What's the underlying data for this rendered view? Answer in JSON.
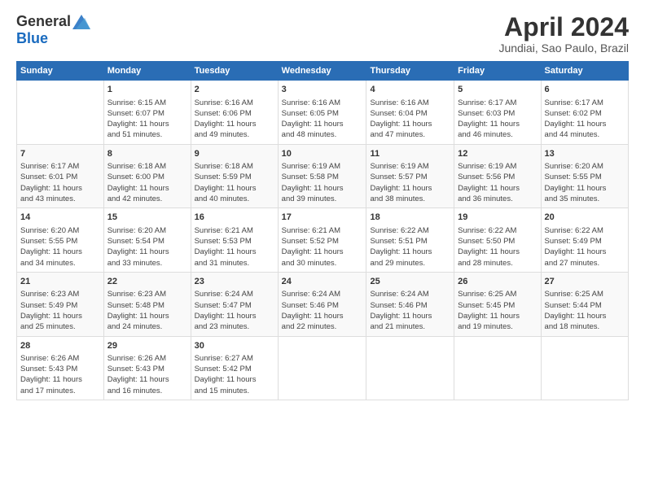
{
  "logo": {
    "general": "General",
    "blue": "Blue"
  },
  "title": "April 2024",
  "subtitle": "Jundiai, Sao Paulo, Brazil",
  "headers": [
    "Sunday",
    "Monday",
    "Tuesday",
    "Wednesday",
    "Thursday",
    "Friday",
    "Saturday"
  ],
  "weeks": [
    [
      {
        "day": "",
        "sunrise": "",
        "sunset": "",
        "daylight": ""
      },
      {
        "day": "1",
        "sunrise": "Sunrise: 6:15 AM",
        "sunset": "Sunset: 6:07 PM",
        "daylight": "Daylight: 11 hours and 51 minutes."
      },
      {
        "day": "2",
        "sunrise": "Sunrise: 6:16 AM",
        "sunset": "Sunset: 6:06 PM",
        "daylight": "Daylight: 11 hours and 49 minutes."
      },
      {
        "day": "3",
        "sunrise": "Sunrise: 6:16 AM",
        "sunset": "Sunset: 6:05 PM",
        "daylight": "Daylight: 11 hours and 48 minutes."
      },
      {
        "day": "4",
        "sunrise": "Sunrise: 6:16 AM",
        "sunset": "Sunset: 6:04 PM",
        "daylight": "Daylight: 11 hours and 47 minutes."
      },
      {
        "day": "5",
        "sunrise": "Sunrise: 6:17 AM",
        "sunset": "Sunset: 6:03 PM",
        "daylight": "Daylight: 11 hours and 46 minutes."
      },
      {
        "day": "6",
        "sunrise": "Sunrise: 6:17 AM",
        "sunset": "Sunset: 6:02 PM",
        "daylight": "Daylight: 11 hours and 44 minutes."
      }
    ],
    [
      {
        "day": "7",
        "sunrise": "Sunrise: 6:17 AM",
        "sunset": "Sunset: 6:01 PM",
        "daylight": "Daylight: 11 hours and 43 minutes."
      },
      {
        "day": "8",
        "sunrise": "Sunrise: 6:18 AM",
        "sunset": "Sunset: 6:00 PM",
        "daylight": "Daylight: 11 hours and 42 minutes."
      },
      {
        "day": "9",
        "sunrise": "Sunrise: 6:18 AM",
        "sunset": "Sunset: 5:59 PM",
        "daylight": "Daylight: 11 hours and 40 minutes."
      },
      {
        "day": "10",
        "sunrise": "Sunrise: 6:19 AM",
        "sunset": "Sunset: 5:58 PM",
        "daylight": "Daylight: 11 hours and 39 minutes."
      },
      {
        "day": "11",
        "sunrise": "Sunrise: 6:19 AM",
        "sunset": "Sunset: 5:57 PM",
        "daylight": "Daylight: 11 hours and 38 minutes."
      },
      {
        "day": "12",
        "sunrise": "Sunrise: 6:19 AM",
        "sunset": "Sunset: 5:56 PM",
        "daylight": "Daylight: 11 hours and 36 minutes."
      },
      {
        "day": "13",
        "sunrise": "Sunrise: 6:20 AM",
        "sunset": "Sunset: 5:55 PM",
        "daylight": "Daylight: 11 hours and 35 minutes."
      }
    ],
    [
      {
        "day": "14",
        "sunrise": "Sunrise: 6:20 AM",
        "sunset": "Sunset: 5:55 PM",
        "daylight": "Daylight: 11 hours and 34 minutes."
      },
      {
        "day": "15",
        "sunrise": "Sunrise: 6:20 AM",
        "sunset": "Sunset: 5:54 PM",
        "daylight": "Daylight: 11 hours and 33 minutes."
      },
      {
        "day": "16",
        "sunrise": "Sunrise: 6:21 AM",
        "sunset": "Sunset: 5:53 PM",
        "daylight": "Daylight: 11 hours and 31 minutes."
      },
      {
        "day": "17",
        "sunrise": "Sunrise: 6:21 AM",
        "sunset": "Sunset: 5:52 PM",
        "daylight": "Daylight: 11 hours and 30 minutes."
      },
      {
        "day": "18",
        "sunrise": "Sunrise: 6:22 AM",
        "sunset": "Sunset: 5:51 PM",
        "daylight": "Daylight: 11 hours and 29 minutes."
      },
      {
        "day": "19",
        "sunrise": "Sunrise: 6:22 AM",
        "sunset": "Sunset: 5:50 PM",
        "daylight": "Daylight: 11 hours and 28 minutes."
      },
      {
        "day": "20",
        "sunrise": "Sunrise: 6:22 AM",
        "sunset": "Sunset: 5:49 PM",
        "daylight": "Daylight: 11 hours and 27 minutes."
      }
    ],
    [
      {
        "day": "21",
        "sunrise": "Sunrise: 6:23 AM",
        "sunset": "Sunset: 5:49 PM",
        "daylight": "Daylight: 11 hours and 25 minutes."
      },
      {
        "day": "22",
        "sunrise": "Sunrise: 6:23 AM",
        "sunset": "Sunset: 5:48 PM",
        "daylight": "Daylight: 11 hours and 24 minutes."
      },
      {
        "day": "23",
        "sunrise": "Sunrise: 6:24 AM",
        "sunset": "Sunset: 5:47 PM",
        "daylight": "Daylight: 11 hours and 23 minutes."
      },
      {
        "day": "24",
        "sunrise": "Sunrise: 6:24 AM",
        "sunset": "Sunset: 5:46 PM",
        "daylight": "Daylight: 11 hours and 22 minutes."
      },
      {
        "day": "25",
        "sunrise": "Sunrise: 6:24 AM",
        "sunset": "Sunset: 5:46 PM",
        "daylight": "Daylight: 11 hours and 21 minutes."
      },
      {
        "day": "26",
        "sunrise": "Sunrise: 6:25 AM",
        "sunset": "Sunset: 5:45 PM",
        "daylight": "Daylight: 11 hours and 19 minutes."
      },
      {
        "day": "27",
        "sunrise": "Sunrise: 6:25 AM",
        "sunset": "Sunset: 5:44 PM",
        "daylight": "Daylight: 11 hours and 18 minutes."
      }
    ],
    [
      {
        "day": "28",
        "sunrise": "Sunrise: 6:26 AM",
        "sunset": "Sunset: 5:43 PM",
        "daylight": "Daylight: 11 hours and 17 minutes."
      },
      {
        "day": "29",
        "sunrise": "Sunrise: 6:26 AM",
        "sunset": "Sunset: 5:43 PM",
        "daylight": "Daylight: 11 hours and 16 minutes."
      },
      {
        "day": "30",
        "sunrise": "Sunrise: 6:27 AM",
        "sunset": "Sunset: 5:42 PM",
        "daylight": "Daylight: 11 hours and 15 minutes."
      },
      {
        "day": "",
        "sunrise": "",
        "sunset": "",
        "daylight": ""
      },
      {
        "day": "",
        "sunrise": "",
        "sunset": "",
        "daylight": ""
      },
      {
        "day": "",
        "sunrise": "",
        "sunset": "",
        "daylight": ""
      },
      {
        "day": "",
        "sunrise": "",
        "sunset": "",
        "daylight": ""
      }
    ]
  ]
}
